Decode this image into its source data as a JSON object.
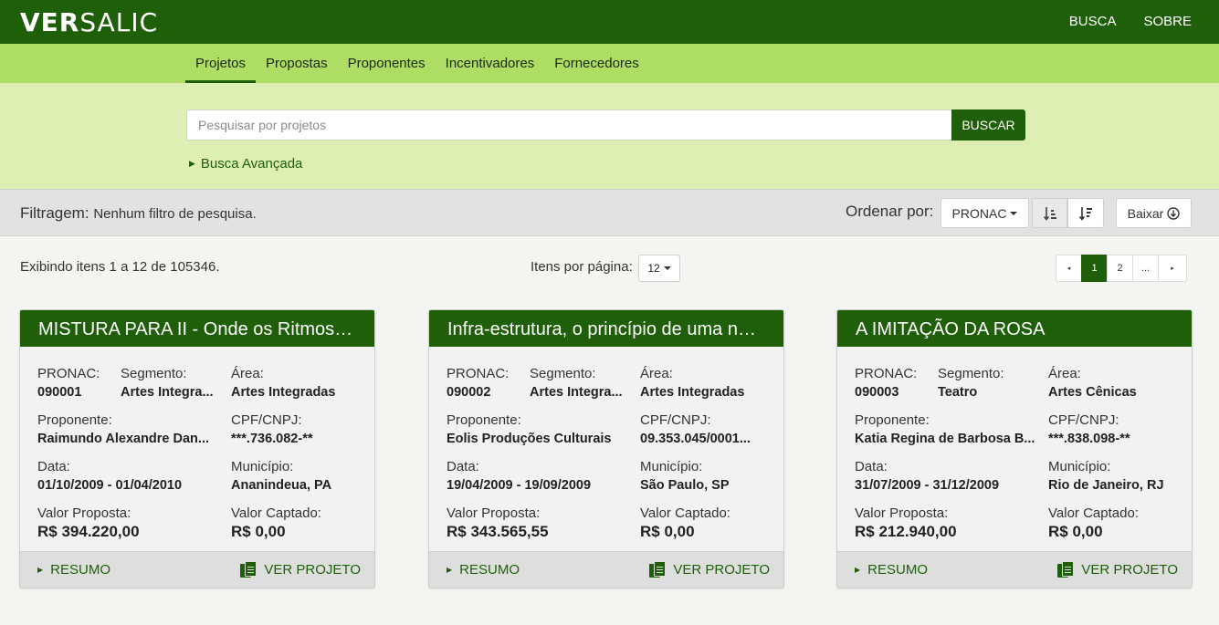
{
  "header": {
    "logo_bold": "VER",
    "logo_light": "SALIC",
    "nav": [
      "BUSCA",
      "SOBRE"
    ]
  },
  "tabs": [
    "Projetos",
    "Propostas",
    "Proponentes",
    "Incentivadores",
    "Fornecedores"
  ],
  "active_tab": "Projetos",
  "search": {
    "placeholder": "Pesquisar por projetos",
    "button": "BUSCAR",
    "advanced": "Busca Avançada"
  },
  "filter": {
    "label": "Filtragem:",
    "value": "Nenhum filtro de pesquisa.",
    "order_label": "Ordenar por:",
    "order_value": "PRONAC",
    "download": "Baixar"
  },
  "results": {
    "info": "Exibindo itens 1 a 12 de 105346.",
    "per_page_label": "Itens por página:",
    "per_page_value": "12",
    "pages": [
      "◂",
      "1",
      "2",
      "...",
      "▸"
    ]
  },
  "labels": {
    "pronac": "PRONAC:",
    "segmento": "Segmento:",
    "area": "Área:",
    "proponente": "Proponente:",
    "cpf": "CPF/CNPJ:",
    "data": "Data:",
    "municipio": "Município:",
    "valor_proposta": "Valor Proposta:",
    "valor_captado": "Valor Captado:",
    "resumo": "RESUMO",
    "ver_projeto": "VER PROJETO"
  },
  "cards": [
    {
      "title": "MISTURA PARA II - Onde os Ritmos s...",
      "pronac": "090001",
      "segmento": "Artes Integra...",
      "area": "Artes Integradas",
      "proponente": "Raimundo Alexandre Dan...",
      "cpf": "***.736.082-**",
      "data": "01/10/2009 - 01/04/2010",
      "municipio": "Ananindeua, PA",
      "valor_proposta": "R$ 394.220,00",
      "valor_captado": "R$ 0,00"
    },
    {
      "title": "Infra-estrutura, o princípio de uma nov...",
      "pronac": "090002",
      "segmento": "Artes Integra...",
      "area": "Artes Integradas",
      "proponente": "Eolis Produções Culturais",
      "cpf": "09.353.045/0001...",
      "data": "19/04/2009 - 19/09/2009",
      "municipio": "São Paulo, SP",
      "valor_proposta": "R$ 343.565,55",
      "valor_captado": "R$ 0,00"
    },
    {
      "title": "A IMITAÇÃO DA ROSA",
      "pronac": "090003",
      "segmento": "Teatro",
      "area": "Artes Cênicas",
      "proponente": "Katia Regina de Barbosa B...",
      "cpf": "***.838.098-**",
      "data": "31/07/2009 - 31/12/2009",
      "municipio": "Rio de Janeiro, RJ",
      "valor_proposta": "R$ 212.940,00",
      "valor_captado": "R$ 0,00"
    }
  ]
}
